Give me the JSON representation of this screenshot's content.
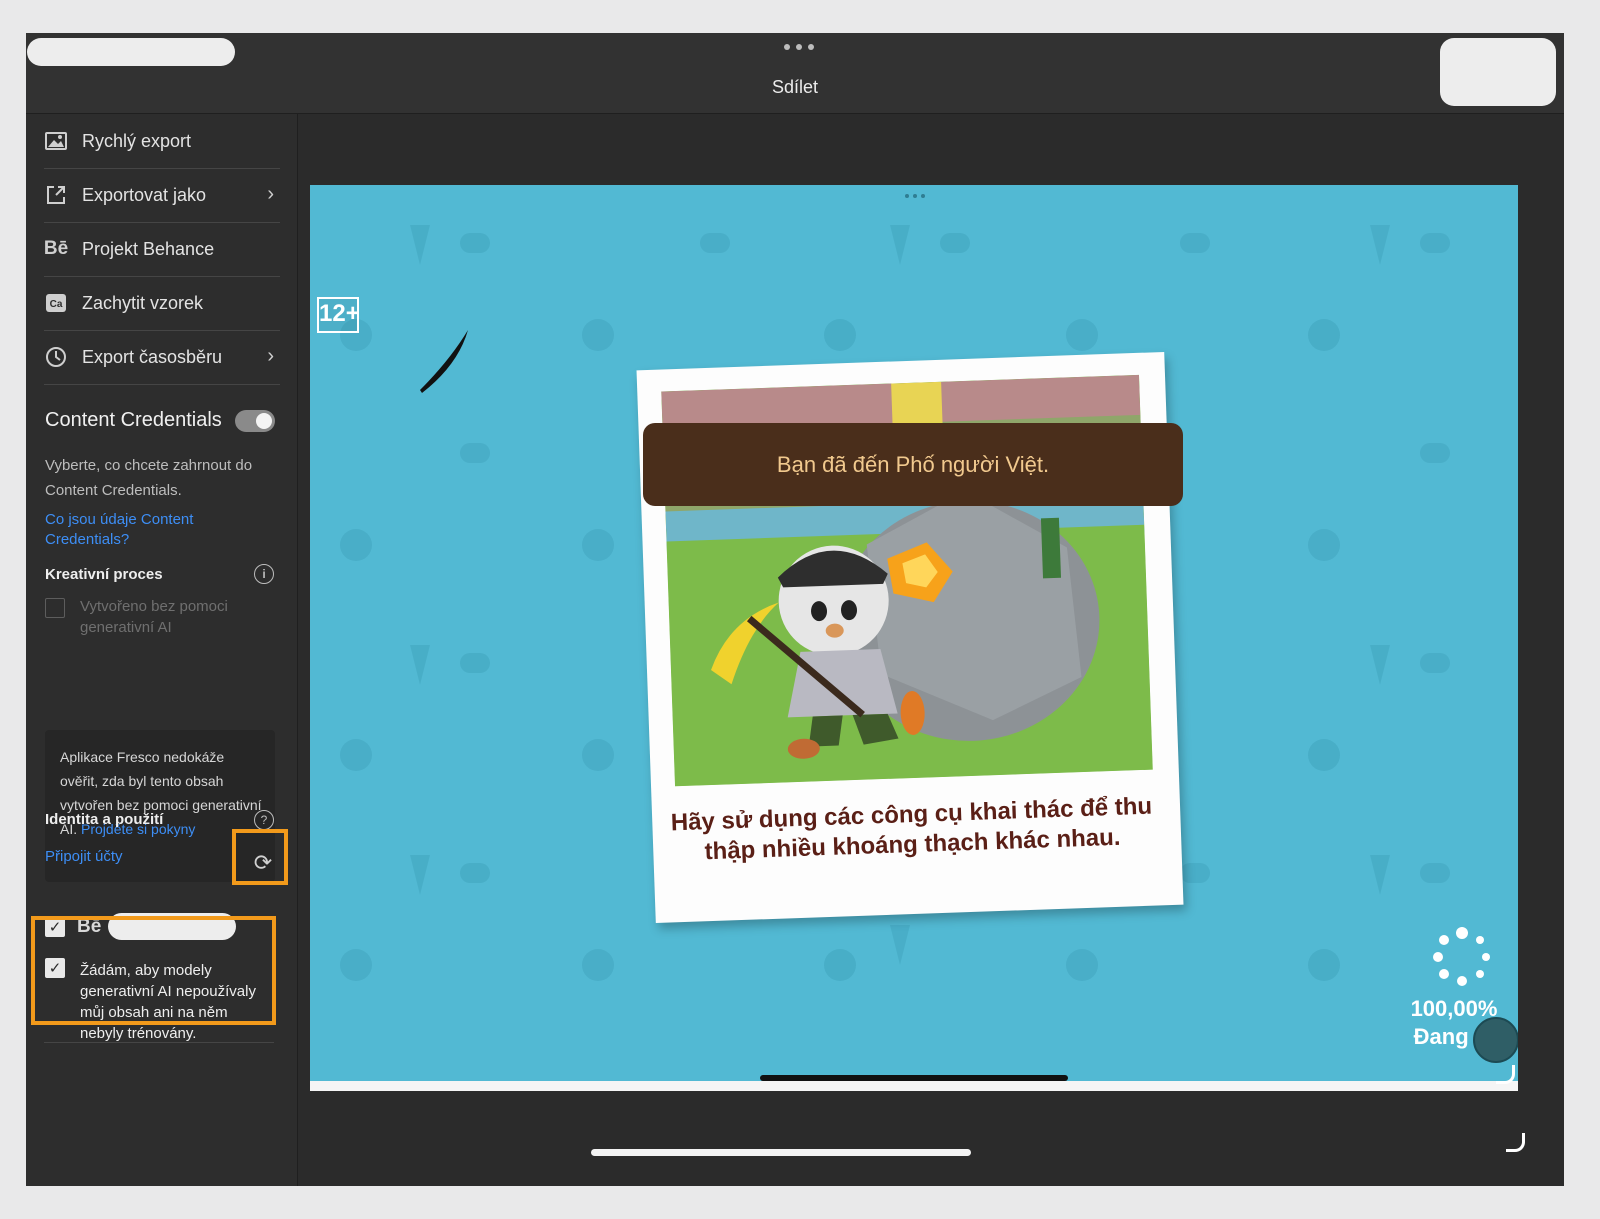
{
  "window": {
    "title": "Sdílet"
  },
  "menu": [
    {
      "label": "Rychlý export",
      "icon": "image-icon",
      "chevron": false
    },
    {
      "label": "Exportovat jako",
      "icon": "export-icon",
      "chevron": true
    },
    {
      "label": "Projekt Behance",
      "icon": "behance-icon",
      "chevron": false
    },
    {
      "label": "Zachytit vzorek",
      "icon": "capture-icon",
      "chevron": false
    },
    {
      "label": "Export časosběru",
      "icon": "clock-icon",
      "chevron": true
    }
  ],
  "content_credentials": {
    "title": "Content Credentials",
    "toggle_on": true,
    "description": "Vyberte, co chcete zahrnout do Content Credentials.",
    "link": "Co jsou údaje Content Credentials?",
    "creative_process": {
      "title": "Kreativní proces",
      "checkbox_label": "Vytvořeno bez pomoci generativní AI",
      "checked": false,
      "notice_text": "Aplikace Fresco nedokáže ověřit, zda byl tento obsah vytvořen bez pomoci generativní AI. ",
      "notice_link": "Projděte si pokyny"
    },
    "identity": {
      "title": "Identita a použití",
      "connect_link": "Připojit účty",
      "behance_label": "Bē",
      "behance_checked": true,
      "ai_optout_label": "Žádám, aby modely generativní AI nepoužívaly můj obsah ani na něm nebyly trénovány.",
      "ai_optout_checked": true
    }
  },
  "preview": {
    "age_rating": "12+",
    "banner_text": "Bạn đã đến Phố người Việt.",
    "caption": "Hãy sử dụng các công cụ khai thác để thu thập nhiều khoáng thạch khác nhau.",
    "progress_text": "100,00%",
    "status_text": "Đang tả"
  },
  "colors": {
    "highlight": "#f29a1b",
    "link": "#3d8ef5",
    "canvas_bg": "#52b9d3"
  }
}
